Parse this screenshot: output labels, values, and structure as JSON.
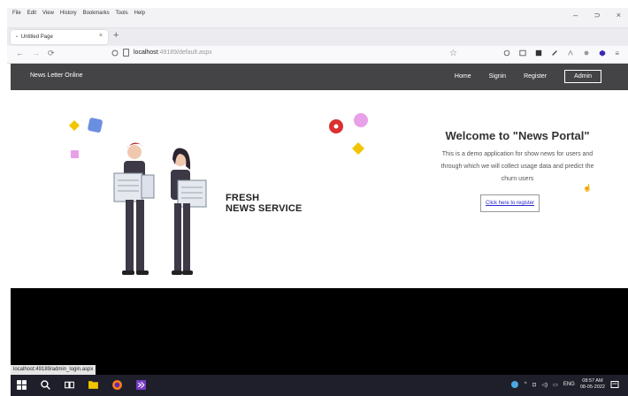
{
  "browser": {
    "menu": [
      "File",
      "Edit",
      "View",
      "History",
      "Bookmarks",
      "Tools",
      "Help"
    ],
    "window_controls": [
      "–",
      "⊃",
      "×"
    ],
    "tab": {
      "title": "Untitled Page",
      "close": "×"
    },
    "new_tab": "+",
    "nav": {
      "back": "←",
      "forward": "→",
      "reload": "⟳"
    },
    "url": {
      "host": "localhost",
      "path": ":49189/default.aspx"
    },
    "bookmark_star": "☆",
    "toolbar_icons": [
      "shield-icon",
      "reader-icon",
      "extension-icon",
      "pen-icon",
      "share-icon",
      "circle-icon",
      "hexagon-icon",
      "menu-icon"
    ]
  },
  "site": {
    "brand": "News Letter Online",
    "links": {
      "home": "Home",
      "signin": "Signin",
      "register": "Register",
      "admin": "Admin"
    },
    "welcome": "Welcome to \"News Portal\"",
    "desc_lines": [
      "This is a demo application for show news for users and",
      "through which we will collect usage data and predict the",
      "churn users"
    ],
    "register_link": "Click here to register",
    "fresh_lines": [
      "FRESH",
      "NEWS SERVICE"
    ]
  },
  "status_url": "localhost:49189/admin_login.aspx",
  "taskbar": {
    "lang": "ENG",
    "time": "08:57 AM",
    "date": "08-05-2022"
  },
  "colors": {
    "navbar": "#444446",
    "accent_red": "#d9312f",
    "accent_yellow": "#f2c500",
    "accent_blue": "#6b8fe0",
    "accent_pink": "#e8a0e8"
  }
}
